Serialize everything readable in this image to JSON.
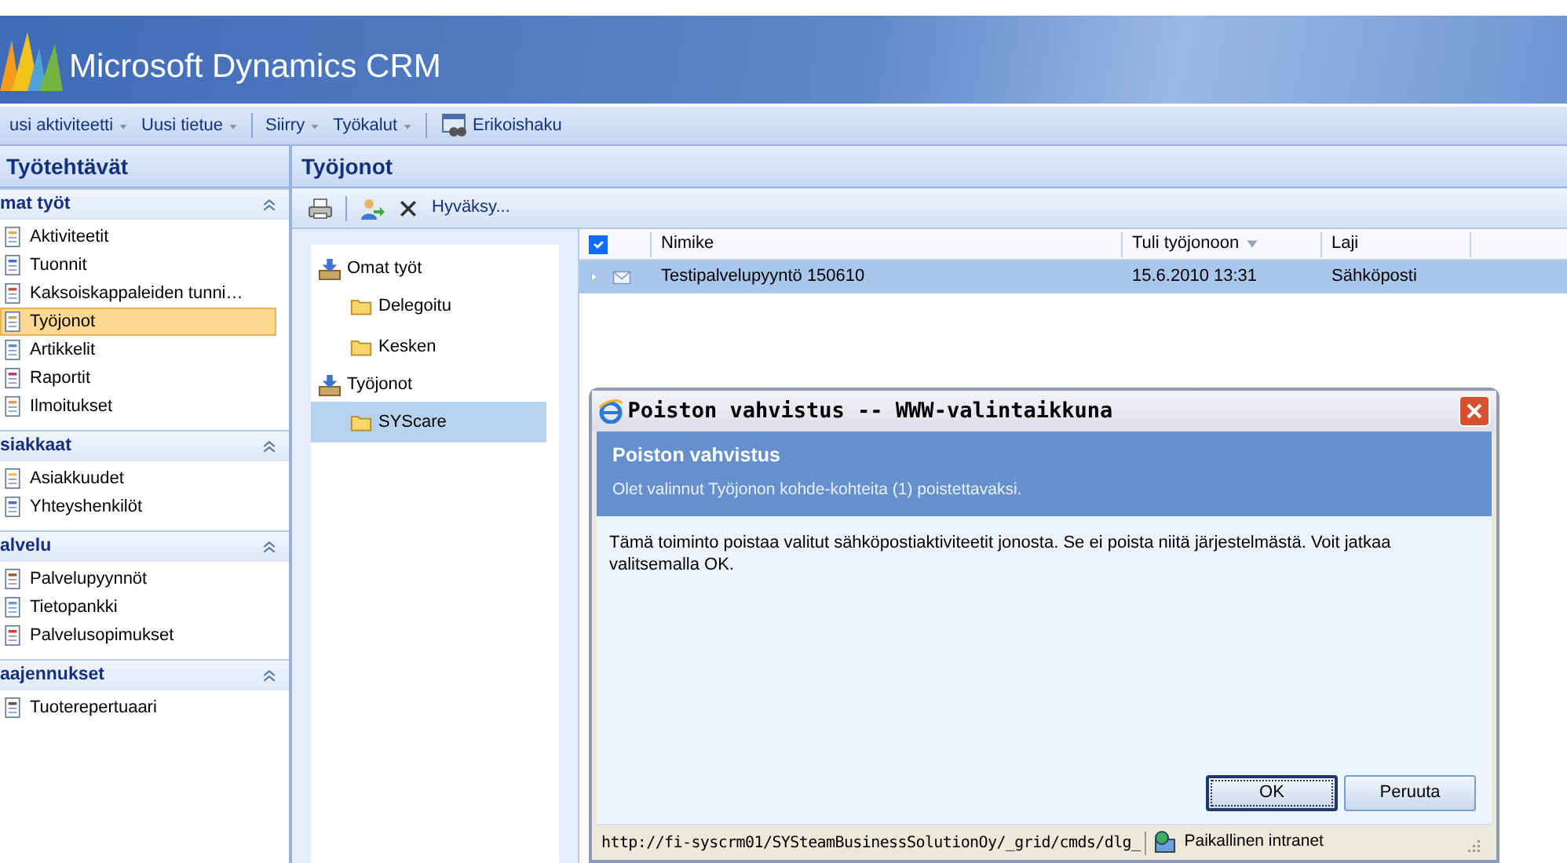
{
  "header": {
    "logo_text": "Microsoft Dynamics CRM"
  },
  "toolbar": [
    {
      "label": "usi aktiviteetti",
      "kind": "menu"
    },
    {
      "label": "Uusi tietue",
      "kind": "menu"
    },
    {
      "kind": "separator"
    },
    {
      "label": "Siirry",
      "kind": "menu"
    },
    {
      "label": "Työkalut",
      "kind": "menu"
    },
    {
      "kind": "separator"
    },
    {
      "label": "Erikoishaku",
      "kind": "search"
    }
  ],
  "left_pane": {
    "title": "Työtehtävät",
    "sections": [
      {
        "title": "mat työt",
        "expanded": true,
        "items": [
          {
            "label": "Aktiviteetit",
            "selected": false
          },
          {
            "label": "Tuonnit",
            "selected": false
          },
          {
            "label": "Kaksoiskappaleiden tunni…",
            "selected": false
          },
          {
            "label": "Työjonot",
            "selected": true
          },
          {
            "label": "Artikkelit",
            "selected": false
          },
          {
            "label": "Raportit",
            "selected": false
          },
          {
            "label": "Ilmoitukset",
            "selected": false
          }
        ]
      },
      {
        "title": "siakkaat",
        "expanded": true,
        "items": [
          {
            "label": "Asiakkuudet",
            "selected": false
          },
          {
            "label": "Yhteyshenkilöt",
            "selected": false
          }
        ]
      },
      {
        "title": "alvelu",
        "expanded": true,
        "items": [
          {
            "label": "Palvelupyynnöt",
            "selected": false
          },
          {
            "label": "Tietopankki",
            "selected": false
          },
          {
            "label": "Palvelusopimukset",
            "selected": false
          }
        ]
      },
      {
        "title": "aajennukset",
        "expanded": true,
        "items": [
          {
            "label": "Tuoterepertuaari",
            "selected": false
          }
        ]
      }
    ]
  },
  "main": {
    "title": "Työjonot",
    "toolbar": [
      {
        "kind": "print"
      },
      {
        "kind": "separator"
      },
      {
        "kind": "assign"
      },
      {
        "kind": "delete"
      },
      {
        "kind": "text",
        "label": "Hyväksy..."
      }
    ],
    "tree": [
      {
        "label": "Omat työt",
        "children": [
          {
            "label": "Delegoitu",
            "selected": false
          },
          {
            "label": "Kesken",
            "selected": false
          }
        ]
      },
      {
        "label": "Työjonot",
        "children": [
          {
            "label": "SYScare",
            "selected": true
          }
        ]
      }
    ],
    "grid": {
      "select_all_checked": true,
      "columns": [
        {
          "label": "Nimike",
          "sorted": false
        },
        {
          "label": "Tuli työjonoon",
          "sorted": true
        },
        {
          "label": "Laji",
          "sorted": false
        }
      ],
      "rows": [
        {
          "selected": true,
          "cells": [
            "Testipalvelupyyntö 150610",
            "15.6.2010 13:31",
            "Sähköposti"
          ]
        }
      ]
    }
  },
  "dialog": {
    "title": "Poiston vahvistus -- WWW-valintaikkuna",
    "heading": "Poiston vahvistus",
    "subheading": "Olet valinnut Työjonon kohde-kohteita (1) poistettavaksi.",
    "message": "Tämä toiminto poistaa valitut sähköpostiaktiviteetit jonosta. Se ei poista niitä järjestelmästä. Voit jatkaa valitsemalla OK.",
    "buttons": [
      {
        "label": "OK",
        "default": true
      },
      {
        "label": "Peruuta",
        "default": false
      }
    ],
    "status_url": "http://fi-syscrm01/SYSteamBusinessSolutionOy/_grid/cmds/dlg_",
    "status_zone": "Paikallinen intranet"
  }
}
